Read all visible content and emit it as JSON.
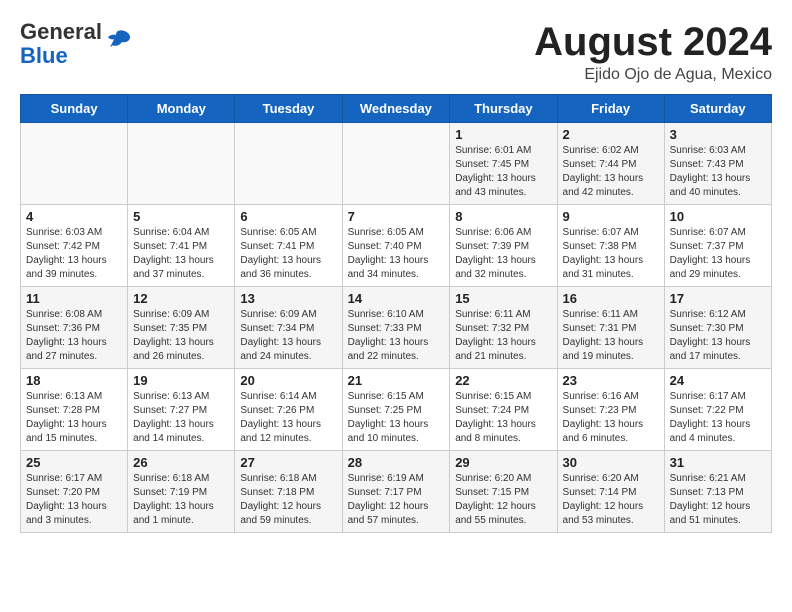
{
  "header": {
    "logo_line1": "General",
    "logo_line2": "Blue",
    "month_year": "August 2024",
    "location": "Ejido Ojo de Agua, Mexico"
  },
  "days_of_week": [
    "Sunday",
    "Monday",
    "Tuesday",
    "Wednesday",
    "Thursday",
    "Friday",
    "Saturday"
  ],
  "weeks": [
    [
      {
        "day": "",
        "info": ""
      },
      {
        "day": "",
        "info": ""
      },
      {
        "day": "",
        "info": ""
      },
      {
        "day": "",
        "info": ""
      },
      {
        "day": "1",
        "info": "Sunrise: 6:01 AM\nSunset: 7:45 PM\nDaylight: 13 hours\nand 43 minutes."
      },
      {
        "day": "2",
        "info": "Sunrise: 6:02 AM\nSunset: 7:44 PM\nDaylight: 13 hours\nand 42 minutes."
      },
      {
        "day": "3",
        "info": "Sunrise: 6:03 AM\nSunset: 7:43 PM\nDaylight: 13 hours\nand 40 minutes."
      }
    ],
    [
      {
        "day": "4",
        "info": "Sunrise: 6:03 AM\nSunset: 7:42 PM\nDaylight: 13 hours\nand 39 minutes."
      },
      {
        "day": "5",
        "info": "Sunrise: 6:04 AM\nSunset: 7:41 PM\nDaylight: 13 hours\nand 37 minutes."
      },
      {
        "day": "6",
        "info": "Sunrise: 6:05 AM\nSunset: 7:41 PM\nDaylight: 13 hours\nand 36 minutes."
      },
      {
        "day": "7",
        "info": "Sunrise: 6:05 AM\nSunset: 7:40 PM\nDaylight: 13 hours\nand 34 minutes."
      },
      {
        "day": "8",
        "info": "Sunrise: 6:06 AM\nSunset: 7:39 PM\nDaylight: 13 hours\nand 32 minutes."
      },
      {
        "day": "9",
        "info": "Sunrise: 6:07 AM\nSunset: 7:38 PM\nDaylight: 13 hours\nand 31 minutes."
      },
      {
        "day": "10",
        "info": "Sunrise: 6:07 AM\nSunset: 7:37 PM\nDaylight: 13 hours\nand 29 minutes."
      }
    ],
    [
      {
        "day": "11",
        "info": "Sunrise: 6:08 AM\nSunset: 7:36 PM\nDaylight: 13 hours\nand 27 minutes."
      },
      {
        "day": "12",
        "info": "Sunrise: 6:09 AM\nSunset: 7:35 PM\nDaylight: 13 hours\nand 26 minutes."
      },
      {
        "day": "13",
        "info": "Sunrise: 6:09 AM\nSunset: 7:34 PM\nDaylight: 13 hours\nand 24 minutes."
      },
      {
        "day": "14",
        "info": "Sunrise: 6:10 AM\nSunset: 7:33 PM\nDaylight: 13 hours\nand 22 minutes."
      },
      {
        "day": "15",
        "info": "Sunrise: 6:11 AM\nSunset: 7:32 PM\nDaylight: 13 hours\nand 21 minutes."
      },
      {
        "day": "16",
        "info": "Sunrise: 6:11 AM\nSunset: 7:31 PM\nDaylight: 13 hours\nand 19 minutes."
      },
      {
        "day": "17",
        "info": "Sunrise: 6:12 AM\nSunset: 7:30 PM\nDaylight: 13 hours\nand 17 minutes."
      }
    ],
    [
      {
        "day": "18",
        "info": "Sunrise: 6:13 AM\nSunset: 7:28 PM\nDaylight: 13 hours\nand 15 minutes."
      },
      {
        "day": "19",
        "info": "Sunrise: 6:13 AM\nSunset: 7:27 PM\nDaylight: 13 hours\nand 14 minutes."
      },
      {
        "day": "20",
        "info": "Sunrise: 6:14 AM\nSunset: 7:26 PM\nDaylight: 13 hours\nand 12 minutes."
      },
      {
        "day": "21",
        "info": "Sunrise: 6:15 AM\nSunset: 7:25 PM\nDaylight: 13 hours\nand 10 minutes."
      },
      {
        "day": "22",
        "info": "Sunrise: 6:15 AM\nSunset: 7:24 PM\nDaylight: 13 hours\nand 8 minutes."
      },
      {
        "day": "23",
        "info": "Sunrise: 6:16 AM\nSunset: 7:23 PM\nDaylight: 13 hours\nand 6 minutes."
      },
      {
        "day": "24",
        "info": "Sunrise: 6:17 AM\nSunset: 7:22 PM\nDaylight: 13 hours\nand 4 minutes."
      }
    ],
    [
      {
        "day": "25",
        "info": "Sunrise: 6:17 AM\nSunset: 7:20 PM\nDaylight: 13 hours\nand 3 minutes."
      },
      {
        "day": "26",
        "info": "Sunrise: 6:18 AM\nSunset: 7:19 PM\nDaylight: 13 hours\nand 1 minute."
      },
      {
        "day": "27",
        "info": "Sunrise: 6:18 AM\nSunset: 7:18 PM\nDaylight: 12 hours\nand 59 minutes."
      },
      {
        "day": "28",
        "info": "Sunrise: 6:19 AM\nSunset: 7:17 PM\nDaylight: 12 hours\nand 57 minutes."
      },
      {
        "day": "29",
        "info": "Sunrise: 6:20 AM\nSunset: 7:15 PM\nDaylight: 12 hours\nand 55 minutes."
      },
      {
        "day": "30",
        "info": "Sunrise: 6:20 AM\nSunset: 7:14 PM\nDaylight: 12 hours\nand 53 minutes."
      },
      {
        "day": "31",
        "info": "Sunrise: 6:21 AM\nSunset: 7:13 PM\nDaylight: 12 hours\nand 51 minutes."
      }
    ]
  ]
}
